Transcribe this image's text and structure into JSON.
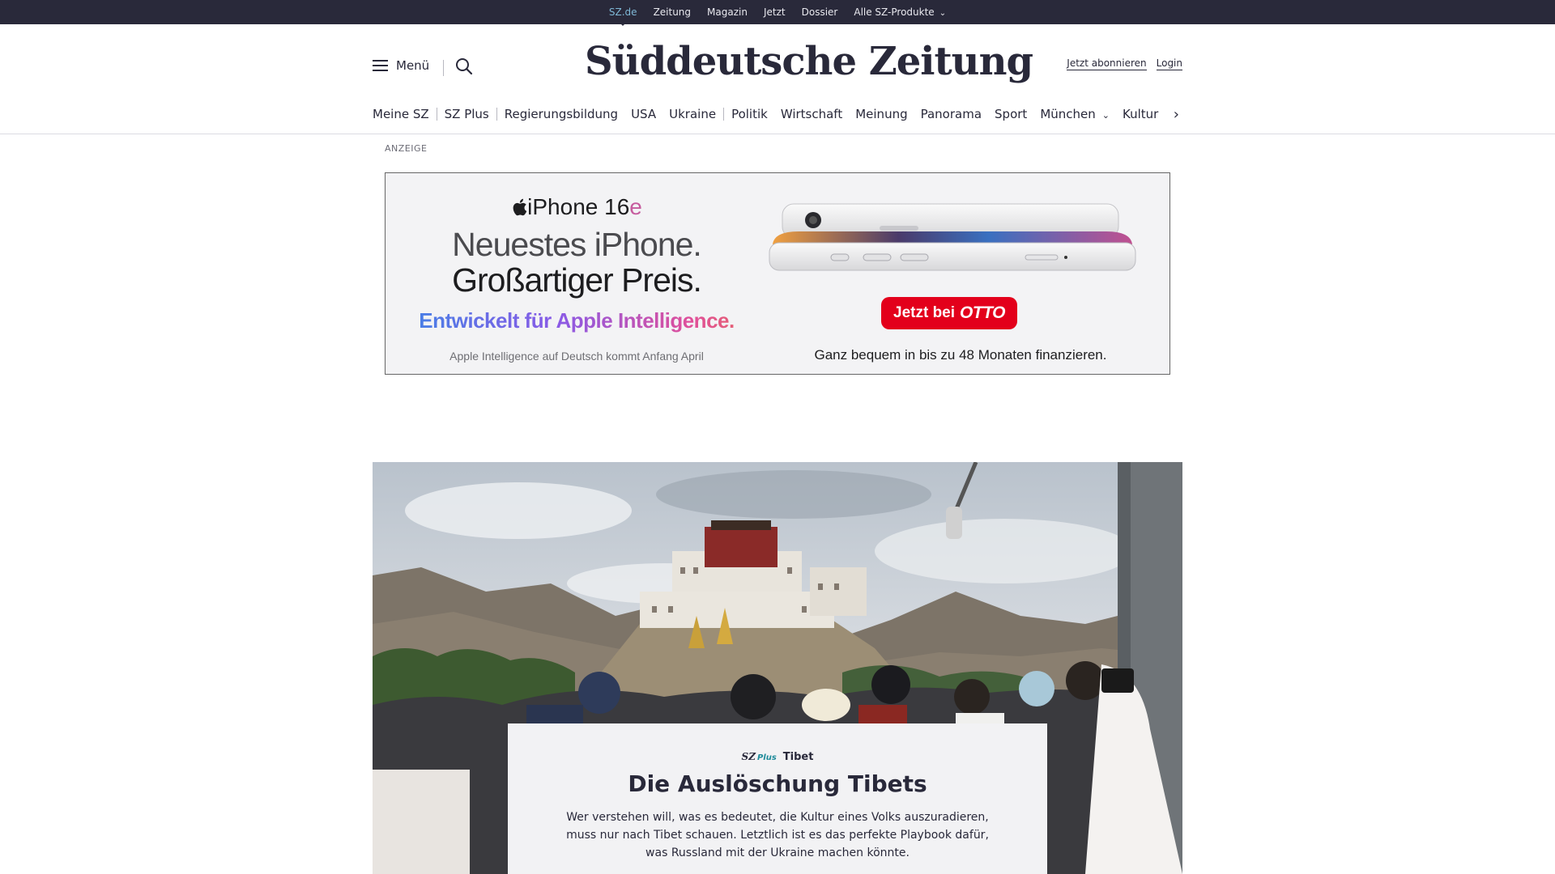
{
  "topbar": {
    "items": [
      "SZ.de",
      "Zeitung",
      "Magazin",
      "Jetzt",
      "Dossier",
      "Alle SZ-Produkte"
    ]
  },
  "header": {
    "menu_label": "Menü",
    "logo_text": "Süddeutsche Zeitung",
    "subscribe_label": "Jetzt abonnieren",
    "login_label": "Login"
  },
  "nav": {
    "items": [
      "Meine SZ",
      "SZ Plus",
      "Regierungsbildung",
      "USA",
      "Ukraine",
      "Politik",
      "Wirtschaft",
      "Meinung",
      "Panorama",
      "Sport",
      "München",
      "Kultur"
    ]
  },
  "ad": {
    "label": "ANZEIGE",
    "brand_prefix": "iPhone 16",
    "brand_suffix": "e",
    "headline_1": "Neuestes iPhone.",
    "headline_2": "Großartiger Preis.",
    "tagline": "Entwickelt für Apple Intelligence.",
    "small_text": "Apple Intelligence auf Deutsch kommt Anfang April",
    "cta_prefix": "Jetzt bei",
    "cta_brand": "OTTO",
    "finance_text": "Ganz bequem in bis zu 48 Monaten finanzieren."
  },
  "teaser": {
    "badge_sz": "SZ",
    "badge_plus": "Plus",
    "kicker": "Tibet",
    "title": "Die Auslöschung Tibets",
    "text": "Wer verstehen will, was es bedeutet, die Kultur eines Volks auszuradieren, muss nur nach Tibet schauen. Letztlich ist es das perfekte Playbook dafür, was Russland mit der Ukraine machen könnte."
  },
  "colors": {
    "topbar_bg": "#29293a",
    "active_link": "#7fb8d6",
    "otto_red": "#e3001b",
    "sz_plus_teal": "#1f8b9a"
  }
}
